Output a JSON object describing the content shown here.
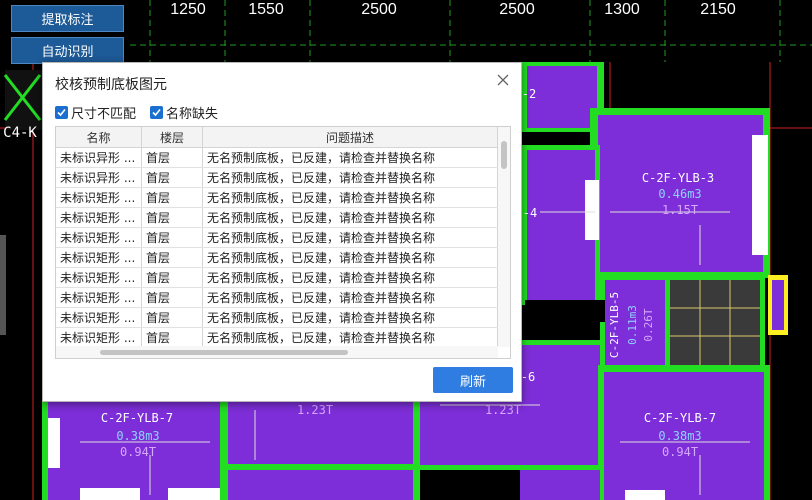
{
  "toolbar": {
    "extract_label": "提取标注",
    "auto_label": "自动识别"
  },
  "dimensions": [
    "1250",
    "1550",
    "2500",
    "2500",
    "1300",
    "2150"
  ],
  "cad_labels": {
    "left_tag": "C4-K",
    "slab_b_name": "C-2F-YLB-3",
    "slab_b_vol": "0.46m3",
    "slab_b_wt": "1.15T",
    "slab_c_name": "C-2F-YLB-5",
    "slab_c_vol": "0.11m3",
    "slab_c_wt": "0.26T",
    "slab_d_name": "C-2F-YLB-7",
    "slab_d_vol": "0.38m3",
    "slab_d_wt": "0.94T",
    "slab_e_name": "C-2F-YLB-7",
    "slab_e_vol": "0.38m3",
    "slab_e_wt": "0.94T",
    "partial_1": "-2",
    "partial_2": "-4",
    "partial_3": "-6",
    "partial_wt_1": "1.23T",
    "partial_wt_2": "1.23T"
  },
  "dialog": {
    "title": "校核预制底板图元",
    "filters": [
      {
        "label": "尺寸不匹配",
        "checked": true
      },
      {
        "label": "名称缺失",
        "checked": true
      }
    ],
    "columns": [
      "名称",
      "楼层",
      "问题描述"
    ],
    "rows": [
      {
        "name": "未标识异形 ...",
        "floor": "首层",
        "desc": "无名预制底板，已反建，请检查并替换名称"
      },
      {
        "name": "未标识异形 ...",
        "floor": "首层",
        "desc": "无名预制底板，已反建，请检查并替换名称"
      },
      {
        "name": "未标识矩形 ...",
        "floor": "首层",
        "desc": "无名预制底板，已反建，请检查并替换名称"
      },
      {
        "name": "未标识矩形 ...",
        "floor": "首层",
        "desc": "无名预制底板，已反建，请检查并替换名称"
      },
      {
        "name": "未标识矩形 ...",
        "floor": "首层",
        "desc": "无名预制底板，已反建，请检查并替换名称"
      },
      {
        "name": "未标识矩形 ...",
        "floor": "首层",
        "desc": "无名预制底板，已反建，请检查并替换名称"
      },
      {
        "name": "未标识矩形 ...",
        "floor": "首层",
        "desc": "无名预制底板，已反建，请检查并替换名称"
      },
      {
        "name": "未标识矩形 ...",
        "floor": "首层",
        "desc": "无名预制底板，已反建，请检查并替换名称"
      },
      {
        "name": "未标识矩形 ...",
        "floor": "首层",
        "desc": "无名预制底板，已反建，请检查并替换名称"
      },
      {
        "name": "未标识矩形 ...",
        "floor": "首层",
        "desc": "无名预制底板，已反建，请检查并替换名称"
      }
    ],
    "refresh_label": "刷新"
  },
  "colors": {
    "slab_fill": "#7d2ed8",
    "wall_green": "#22dd22",
    "accent_blue": "#2f7de0"
  }
}
